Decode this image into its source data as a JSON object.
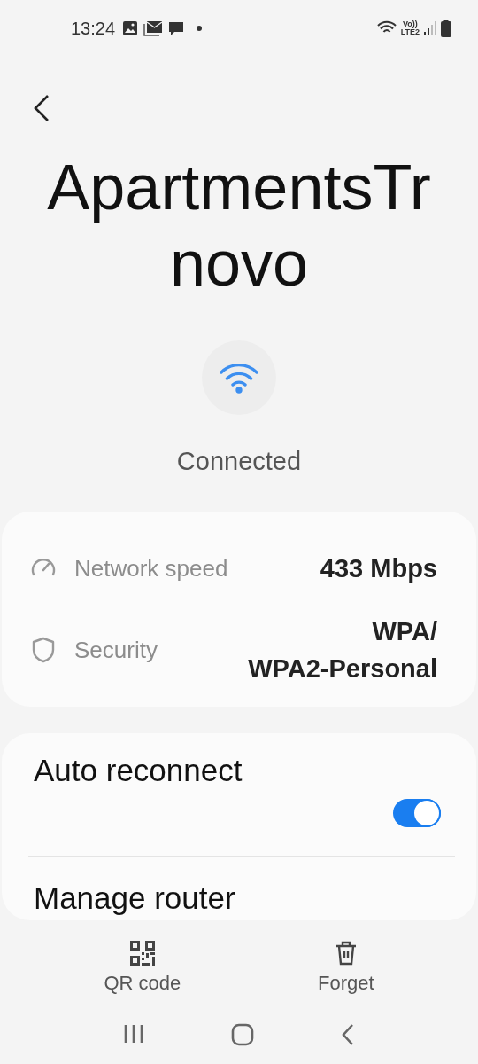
{
  "status_bar": {
    "time": "13:24",
    "network_top": "Vo))",
    "network_bottom": "LTE2"
  },
  "network": {
    "name": "ApartmentsTrnovo",
    "status": "Connected"
  },
  "details": [
    {
      "kind": "speed",
      "label": "Network speed",
      "value": "433 Mbps"
    },
    {
      "kind": "security",
      "label": "Security",
      "value": "WPA/\nWPA2-Personal"
    }
  ],
  "settings": [
    {
      "kind": "toggle",
      "label": "Auto reconnect",
      "on": true
    },
    {
      "kind": "link",
      "label": "Manage router"
    }
  ],
  "actions": [
    {
      "kind": "qr",
      "label": "QR code"
    },
    {
      "kind": "forget",
      "label": "Forget"
    }
  ]
}
